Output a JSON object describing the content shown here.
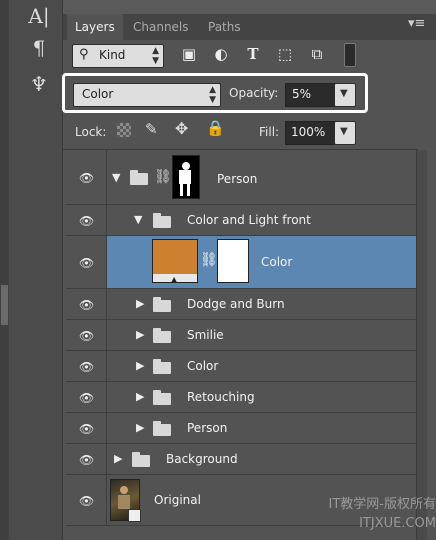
{
  "toolstrip": {
    "tools": [
      {
        "glyph": "A|",
        "icon": "text-tool-icon"
      },
      {
        "glyph": "¶",
        "icon": "paragraph-icon"
      },
      {
        "glyph": "♆",
        "icon": "puppet-warp-icon"
      }
    ]
  },
  "tabs": [
    {
      "label": "Layers",
      "active": true
    },
    {
      "label": "Channels",
      "active": false
    },
    {
      "label": "Paths",
      "active": false
    }
  ],
  "panel_menu": "▾≡",
  "filter": {
    "search_glyph": "⚲",
    "kind_label": "Kind",
    "icons": [
      "▣",
      "◐",
      "T",
      "⬚",
      "⧉"
    ]
  },
  "blend": {
    "mode": "Color",
    "opacity_label": "Opacity:",
    "opacity_value": "5%"
  },
  "lock": {
    "label": "Lock:",
    "fill_label": "Fill:",
    "fill_value": "100%"
  },
  "layers": [
    {
      "name": "Person"
    },
    {
      "name": "Color and Light front"
    },
    {
      "name": "Color"
    },
    {
      "name": "Dodge and Burn"
    },
    {
      "name": "Smilie"
    },
    {
      "name": "Color"
    },
    {
      "name": "Retouching"
    },
    {
      "name": "Person"
    },
    {
      "name": "Background"
    },
    {
      "name": "Original"
    }
  ],
  "colors": {
    "fill_color": "#cc8030",
    "selection": "#5c87b2"
  },
  "watermark": {
    "line1": "IT教学网-版权所有",
    "line2": "ITJXUE.COM"
  }
}
